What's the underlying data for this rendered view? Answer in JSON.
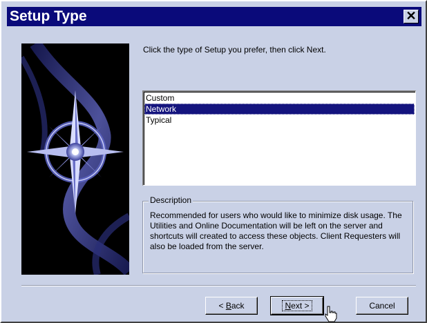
{
  "window": {
    "title": "Setup Type",
    "close_glyph": "✕"
  },
  "side_image": {
    "icon": "compass-star-graphic"
  },
  "prompt": "Click the type of Setup you prefer, then click Next.",
  "setup_types": {
    "items": [
      "Custom",
      "Network",
      "Typical"
    ],
    "selected": "Network"
  },
  "description": {
    "legend": "Description",
    "text": "Recommended for users who would like to minimize disk usage.  The Utilities and Online Documentation will be left on the server and shortcuts will created to access these objects.  Client Requesters will also be loaded from the server."
  },
  "buttons": {
    "back": {
      "prefix": "< ",
      "accel": "B",
      "rest": "ack"
    },
    "next": {
      "accel": "N",
      "rest": "ext >"
    },
    "cancel": "Cancel"
  },
  "colors": {
    "titlebar": "#0a0a7a",
    "dialog_bg": "#c9d1e6",
    "selection": "#14147e"
  }
}
